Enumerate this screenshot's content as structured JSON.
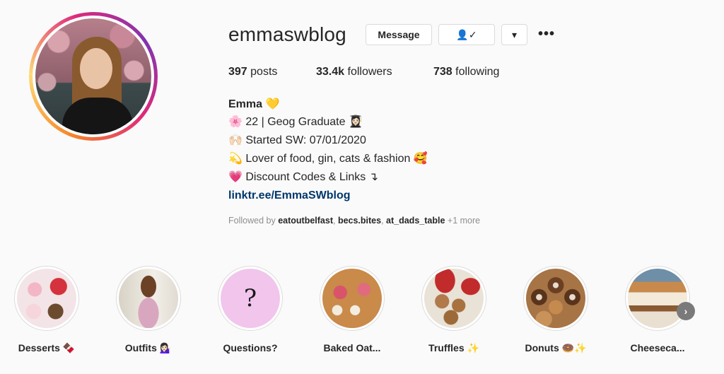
{
  "profile": {
    "username": "emmaswblog",
    "message_label": "Message",
    "following_icon": "👤✓",
    "dropdown_icon": "▾",
    "more_icon": "•••",
    "stats": {
      "posts_count": "397",
      "posts_label": "posts",
      "followers_count": "33.4k",
      "followers_label": "followers",
      "following_count": "738",
      "following_label": "following"
    },
    "bio": {
      "name": "Emma 💛",
      "line1": "🌸 22 | Geog Graduate 👩🏻‍🎓",
      "line2": "🙌🏻 Started SW: 07/01/2020",
      "line3": "💫 Lover of food, gin, cats & fashion 🥰",
      "line4": "💗 Discount Codes & Links ↴",
      "link": "linktr.ee/EmmaSWblog"
    },
    "followed_by": {
      "prefix": "Followed by",
      "users": [
        "eatoutbelfast",
        "becs.bites",
        "at_dads_table"
      ],
      "more": "+1 more"
    }
  },
  "highlights": [
    {
      "label": "Desserts 🍫"
    },
    {
      "label": "Outfits 💁🏻‍♀️"
    },
    {
      "label": "Questions?"
    },
    {
      "label": "Baked Oat..."
    },
    {
      "label": "Truffles ✨"
    },
    {
      "label": "Donuts 🍩✨"
    },
    {
      "label": "Cheeseca..."
    }
  ],
  "questions_glyph": "?",
  "next_icon": "›",
  "colors": {
    "link": "#00376b",
    "text": "#262626",
    "muted": "#8e8e8e",
    "question_bg": "#f1c5ec"
  }
}
